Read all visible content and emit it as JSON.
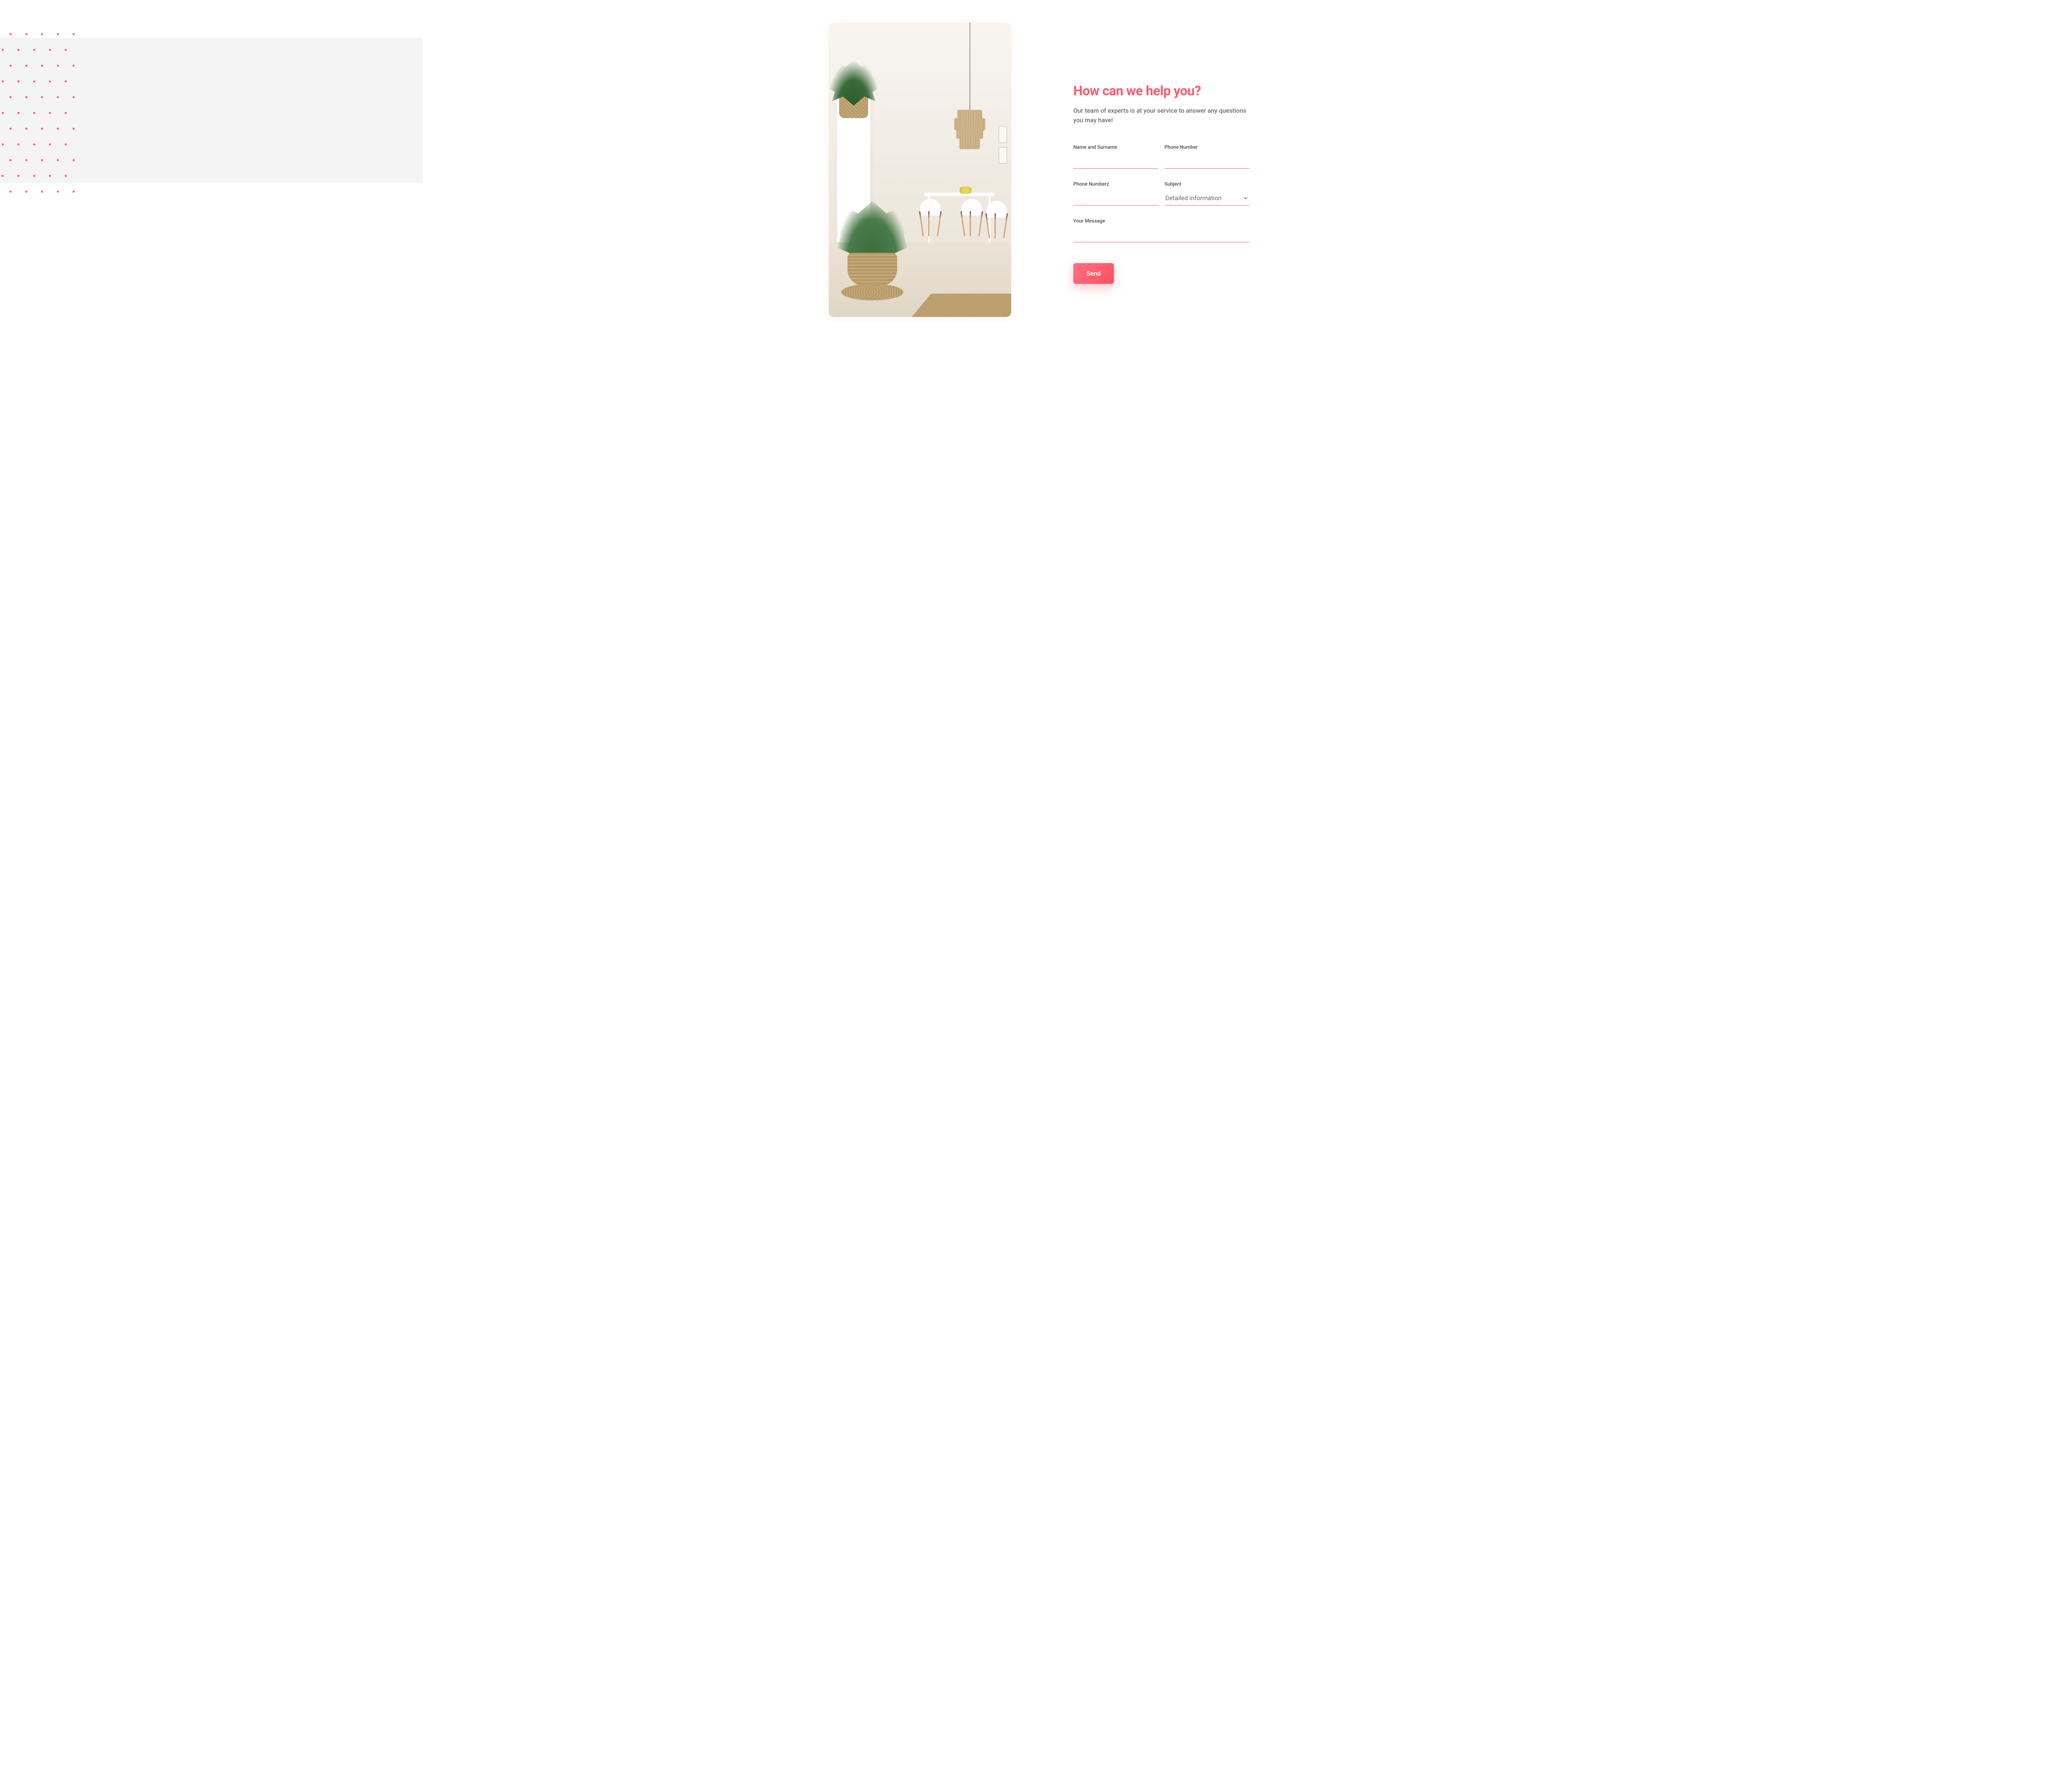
{
  "form": {
    "heading": "How can we help you?",
    "subtitle": "Our team of experts is at your service to answer any questions you may have!",
    "fields": {
      "name": {
        "label": "Name and Surname",
        "value": ""
      },
      "phone1": {
        "label": "Phone Number",
        "value": ""
      },
      "phone2": {
        "label": "Phone Numberz",
        "value": ""
      },
      "subject": {
        "label": "Subject",
        "selected": "Detailed information"
      },
      "message": {
        "label": "Your Message",
        "value": ""
      }
    },
    "submit_label": "Send"
  },
  "colors": {
    "accent": "#ff5a6e",
    "text_secondary": "#6a6a6a",
    "bg_panel": "#f4f4f4"
  }
}
